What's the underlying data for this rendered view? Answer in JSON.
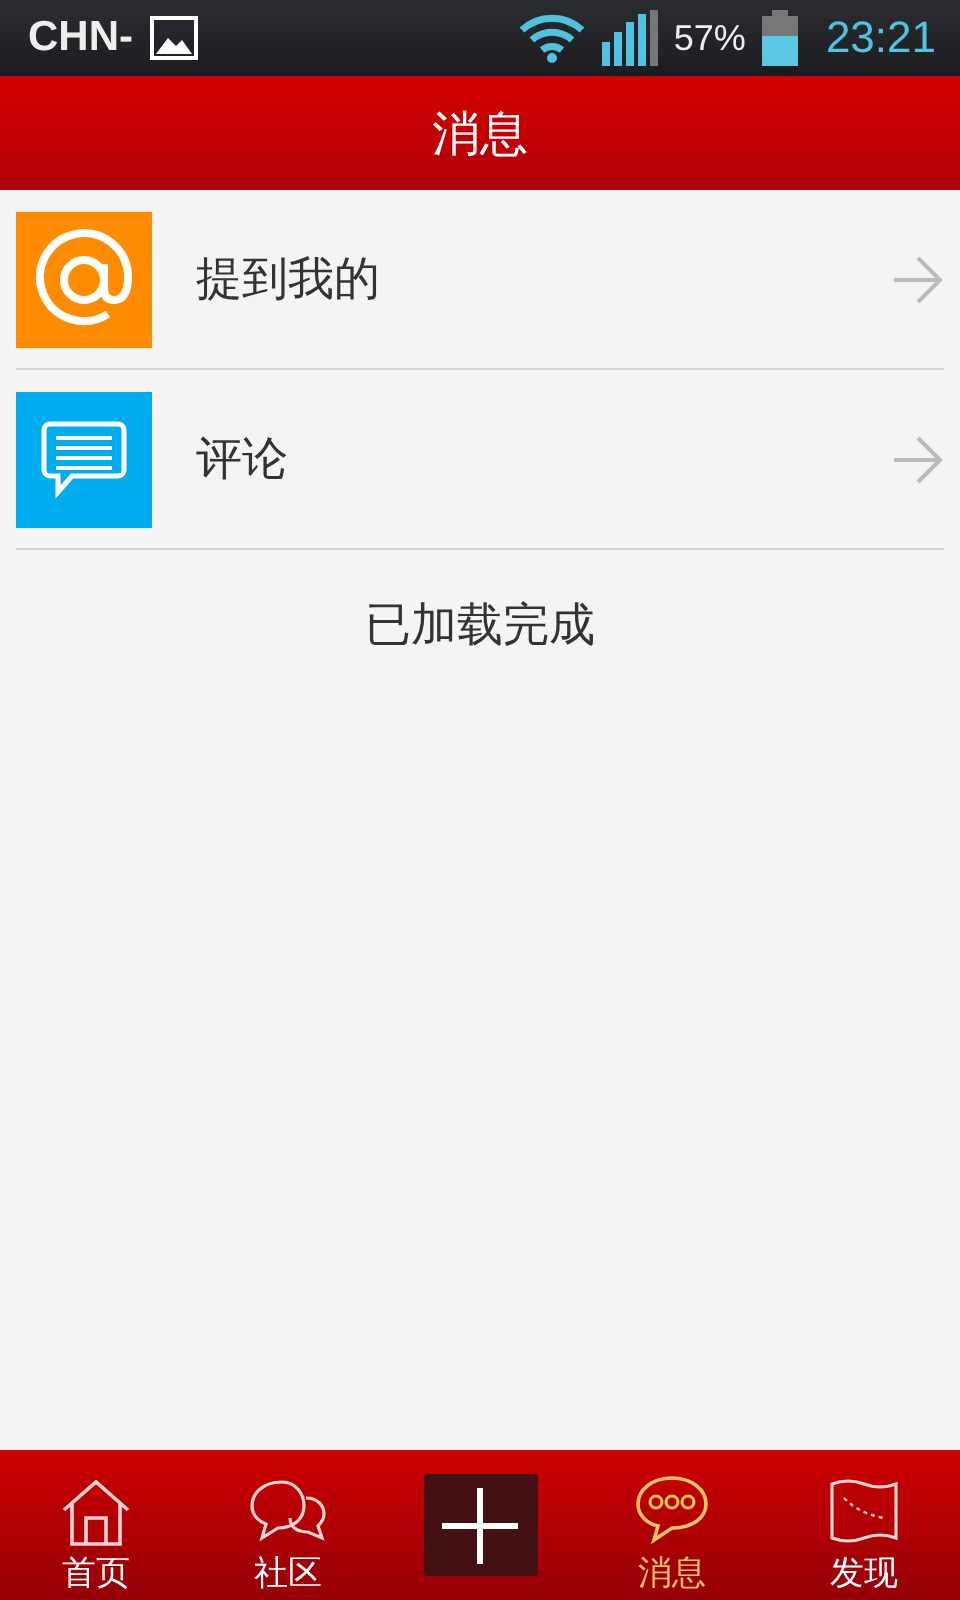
{
  "status_bar": {
    "carrier": "CHN-",
    "battery": "57%",
    "time": "23:21"
  },
  "header": {
    "title": "消息"
  },
  "items": [
    {
      "kind": "mention",
      "label": "提到我的"
    },
    {
      "kind": "comment",
      "label": "评论"
    }
  ],
  "footer_note": "已加载完成",
  "tabs": [
    {
      "kind": "home",
      "label": "首页",
      "selected": false
    },
    {
      "kind": "community",
      "label": "社区",
      "selected": false
    },
    {
      "kind": "add"
    },
    {
      "kind": "messages",
      "label": "消息",
      "selected": true
    },
    {
      "kind": "discover",
      "label": "发现",
      "selected": false
    }
  ]
}
